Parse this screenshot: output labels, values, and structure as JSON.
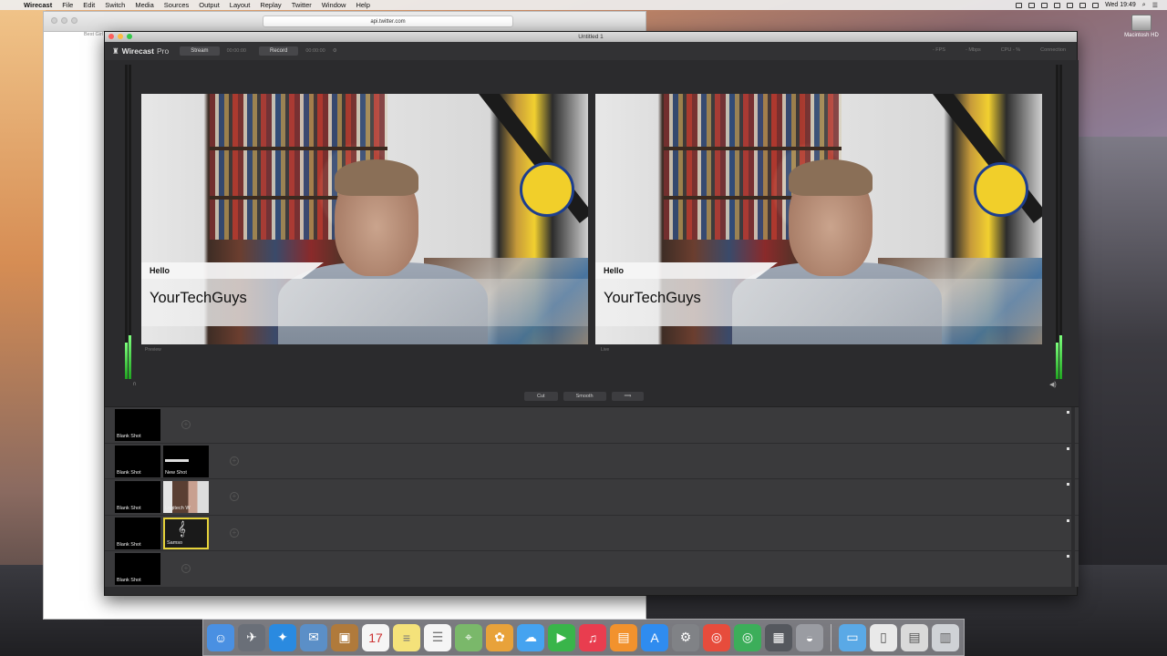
{
  "menubar": {
    "apple_glyph": "",
    "items": [
      "Wirecast",
      "File",
      "Edit",
      "Switch",
      "Media",
      "Sources",
      "Output",
      "Layout",
      "Replay",
      "Twitter",
      "Window",
      "Help"
    ],
    "clock": "Wed 19:49"
  },
  "desktop": {
    "drive_label": "Macintosh HD"
  },
  "browser": {
    "url": "api.twitter.com",
    "tab_text": "Best Girl"
  },
  "wirecast": {
    "window_title": "Untitled 1",
    "brand_name": "Wirecast",
    "brand_edition": "Pro",
    "stream_label": "Stream",
    "stream_time": "00:00:00",
    "record_label": "Record",
    "record_time": "00:00:00",
    "stats": [
      "- FPS",
      "- Mbps",
      "CPU - %",
      "Connection"
    ],
    "preview_label": "Preview",
    "live_label": "Live",
    "transitions": {
      "cut": "Cut",
      "smooth": "Smooth",
      "go": "⟹"
    },
    "lower_third": {
      "line1": "Hello",
      "line2": "YourTechGuys"
    },
    "rows": [
      {
        "shots": [
          {
            "label": "Blank Shot"
          }
        ]
      },
      {
        "shots": [
          {
            "label": "Blank Shot"
          },
          {
            "label": "New Shot"
          }
        ]
      },
      {
        "shots": [
          {
            "label": "Blank Shot"
          },
          {
            "label": "Logitech W"
          }
        ]
      },
      {
        "shots": [
          {
            "label": "Blank Shot"
          },
          {
            "label": "Samso"
          }
        ]
      },
      {
        "shots": [
          {
            "label": "Blank Shot"
          }
        ]
      }
    ]
  },
  "dock": {
    "items": [
      "finder-icon",
      "launchpad-icon",
      "safari-icon",
      "mail-icon",
      "contacts-icon",
      "calendar-icon",
      "notes-icon",
      "reminders-icon",
      "maps-icon",
      "photos-icon",
      "messages-icon",
      "facetime-icon",
      "music-icon",
      "ibooks-icon",
      "appstore-icon",
      "system-preferences-icon",
      "chrome-icon",
      "chrome-alt-icon",
      "wirecast-icon",
      "ftp-icon",
      "folder-icon",
      "documents-icon",
      "downloads-icon",
      "trash-icon"
    ]
  }
}
